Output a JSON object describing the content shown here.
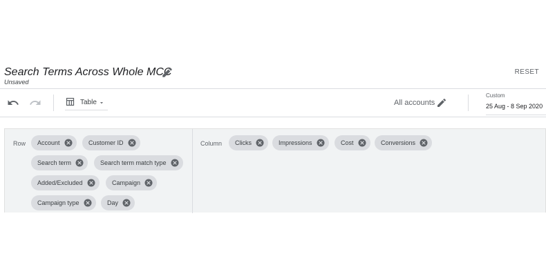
{
  "header": {
    "title": "Search Terms Across Whole MCC",
    "status": "Unsaved",
    "reset_label": "RESET"
  },
  "toolbar": {
    "view_label": "Table",
    "accounts_label": "All accounts",
    "date_label": "Custom",
    "date_range": "25 Aug - 8 Sep 2020"
  },
  "builder": {
    "row_label": "Row",
    "column_label": "Column",
    "row_chips": [
      "Account",
      "Customer ID",
      "Search term",
      "Search term match type",
      "Added/Excluded",
      "Campaign",
      "Campaign type",
      "Day"
    ],
    "column_chips": [
      "Clicks",
      "Impressions",
      "Cost",
      "Conversions"
    ]
  },
  "icons": {
    "edit": "pencil-icon",
    "undo": "undo-icon",
    "redo": "redo-icon",
    "view": "table-icon",
    "dropdown": "caret-down-icon",
    "remove": "close-circle-icon"
  },
  "colors": {
    "chip_bg": "#dadce0",
    "panel_bg": "#f1f3f4",
    "divider": "#dadce0"
  }
}
